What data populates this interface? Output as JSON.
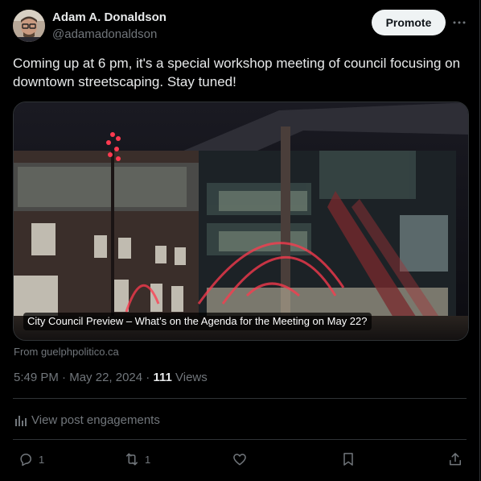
{
  "author": {
    "name": "Adam A. Donaldson",
    "handle": "@adamadonaldson"
  },
  "header": {
    "promote_label": "Promote",
    "more_icon": "ellipsis-icon"
  },
  "post": {
    "text": "Coming up at 6 pm, it's a special workshop meeting of council focusing on downtown streetscaping. Stay tuned!"
  },
  "card": {
    "caption": "City Council Preview – What’s on the Agenda for the Meeting on May 22?",
    "source": "From guelphpolitico.ca"
  },
  "meta": {
    "time": "5:49 PM",
    "sep1": " · ",
    "date": "May 22, 2024",
    "sep2": " · ",
    "views_count": "111",
    "views_label": " Views"
  },
  "engagements": {
    "label": "View post engagements"
  },
  "actions": {
    "replies": "1",
    "reposts": "1"
  },
  "colors": {
    "background": "#000000",
    "text": "#e7e9ea",
    "muted": "#71767b",
    "border": "#2f3336"
  }
}
